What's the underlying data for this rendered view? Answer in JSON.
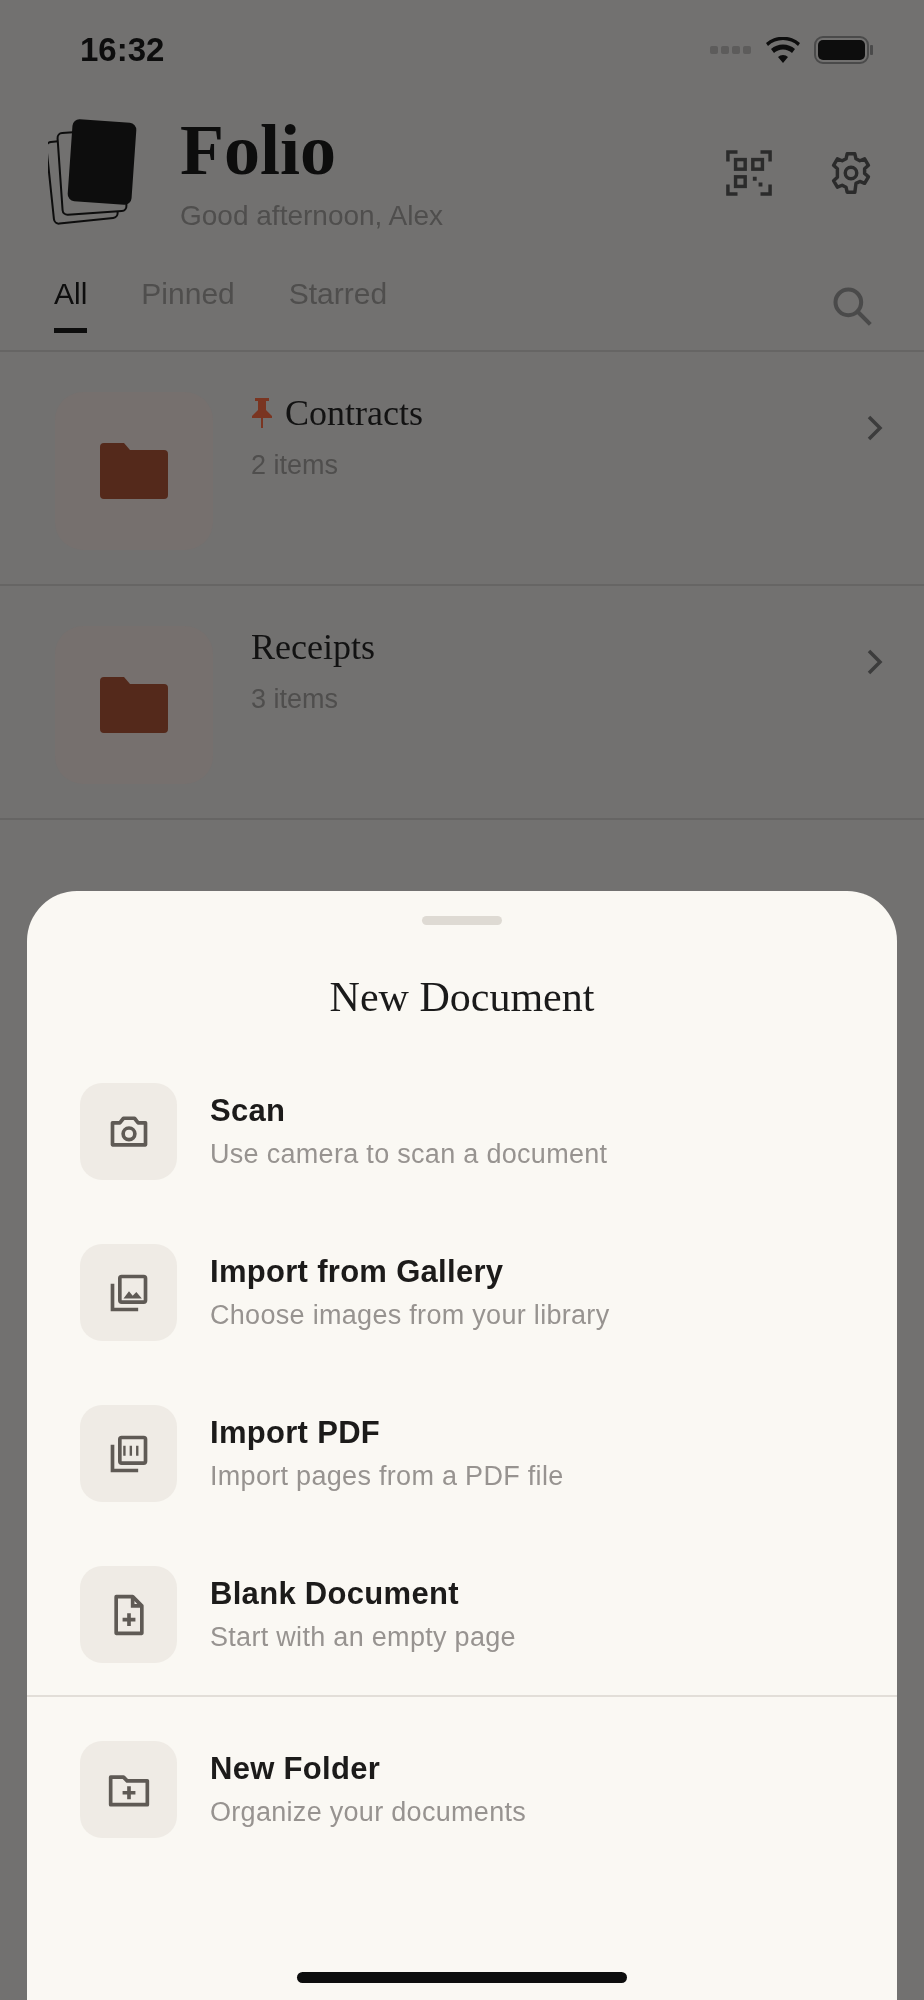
{
  "status_bar": {
    "time": "16:32"
  },
  "header": {
    "title": "Folio",
    "greeting": "Good afternoon, Alex"
  },
  "tabs": [
    {
      "label": "All",
      "selected": true
    },
    {
      "label": "Pinned",
      "selected": false
    },
    {
      "label": "Starred",
      "selected": false
    }
  ],
  "folders": [
    {
      "name": "Contracts",
      "count": "2 items",
      "pinned": true
    },
    {
      "name": "Receipts",
      "count": "3 items",
      "pinned": false
    }
  ],
  "sheet": {
    "title": "New Document",
    "sections": [
      [
        {
          "kind": "camera",
          "title": "Scan",
          "subtitle": "Use camera to scan a document"
        },
        {
          "kind": "gallery",
          "title": "Import from Gallery",
          "subtitle": "Choose images from your library"
        },
        {
          "kind": "pdf",
          "title": "Import PDF",
          "subtitle": "Import pages from a PDF file"
        },
        {
          "kind": "file-plus",
          "title": "Blank Document",
          "subtitle": "Start with an empty page"
        }
      ],
      [
        {
          "kind": "folder-plus",
          "title": "New Folder",
          "subtitle": "Organize your documents"
        }
      ]
    ]
  }
}
